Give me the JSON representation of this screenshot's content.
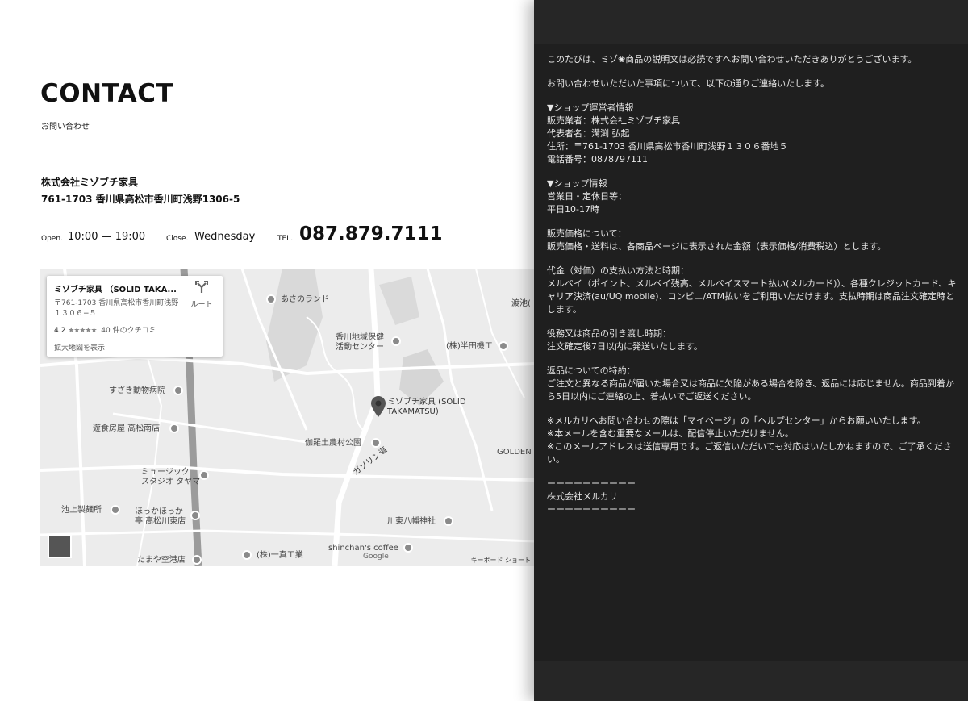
{
  "contact": {
    "title": "CONTACT",
    "subtitle": "お問い合わせ",
    "company": "株式会社ミゾブチ家具",
    "address": "761-1703 香川県高松市香川町浅野1306-5",
    "open_label": "Open.",
    "open_hours": "10:00 — 19:00",
    "close_label": "Close.",
    "close_day": "Wednesday",
    "tel_label": "TEL.",
    "tel": "087.879.7111"
  },
  "map": {
    "card": {
      "place_name": "ミゾブチ家具 （SOLID TAKA...",
      "address": "〒761-1703 香川県高松市香川町浅野１３０６−５",
      "rating": "4.2",
      "stars": "★★★★★",
      "reviews": "40 件のクチコミ",
      "route_label": "ルート",
      "enlarge_label": "拡大地図を表示"
    },
    "labels": {
      "asano_land": "あさのランド",
      "kagawa_center_1": "香川地域保健",
      "kagawa_center_2": "活動センター",
      "handa": "(株)半田機工",
      "suzaki": "すざき動物病院",
      "yushoku": "遊食房屋 高松南店",
      "marker_1": "ミゾブチ家具 (SOLID",
      "marker_2": "TAKAMATSU)",
      "gara_park": "伽羅土農村公園",
      "music_1": "ミュージック",
      "music_2": "スタジオ タヤマ",
      "ikegami": "池上製麺所",
      "hokka_1": "ほっかほっか",
      "hokka_2": "亭 高松川東店",
      "gasoline_road": "ガソリン道",
      "kawahigashi": "川東八幡神社",
      "golden": "GOLDEN",
      "tamaya": "たまや空港店",
      "ichima": "(株)一真工業",
      "shinchan": "shinchan's coffee",
      "tokiike": "渡池(",
      "google": "Google"
    },
    "footer": "キーボード ショート"
  },
  "email": {
    "paragraphs": [
      [
        "このたびは、ミゾ❀商品の説明文は必読ですへお問い合わせいただきありがとうございます。"
      ],
      [
        "お問い合わせいただいた事項について、以下の通りご連絡いたします。"
      ],
      [
        "▼ショップ運営者情報",
        "販売業者：株式会社ミゾブチ家具",
        "代表者名：溝渕 弘起",
        "住所：〒761-1703 香川県高松市香川町浅野１３０６番地５",
        "電話番号：0878797111"
      ],
      [
        "▼ショップ情報",
        "営業日・定休日等：",
        "平日10-17時"
      ],
      [
        "販売価格について：",
        "販売価格・送料は、各商品ページに表示された金額（表示価格/消費税込）とします。"
      ],
      [
        "代金（対価）の支払い方法と時期：",
        "メルペイ（ポイント、メルペイ残高、メルペイスマート払い(メルカード)）、各種クレジットカード、キャリア決済(au/UQ mobile)、コンビニ/ATM払いをご利用いただけます。支払時期は商品注文確定時とします。"
      ],
      [
        "役務又は商品の引き渡し時期：",
        "注文確定後7日以内に発送いたします。"
      ],
      [
        "返品についての特約：",
        "ご注文と異なる商品が届いた場合又は商品に欠陥がある場合を除き、返品には応じません。商品到着から5日以内にご連絡の上、着払いでご返送ください。"
      ],
      [
        "※メルカリへお問い合わせの際は「マイページ」の「ヘルプセンター」からお願いいたします。",
        "※本メールを含む重要なメールは、配信停止いただけません。",
        "※このメールアドレスは送信専用です。ご返信いただいても対応はいたしかねますので、ご了承ください。"
      ],
      [
        "ーーーーーーーーーー",
        "株式会社メルカリ",
        "ーーーーーーーーーー"
      ]
    ]
  }
}
